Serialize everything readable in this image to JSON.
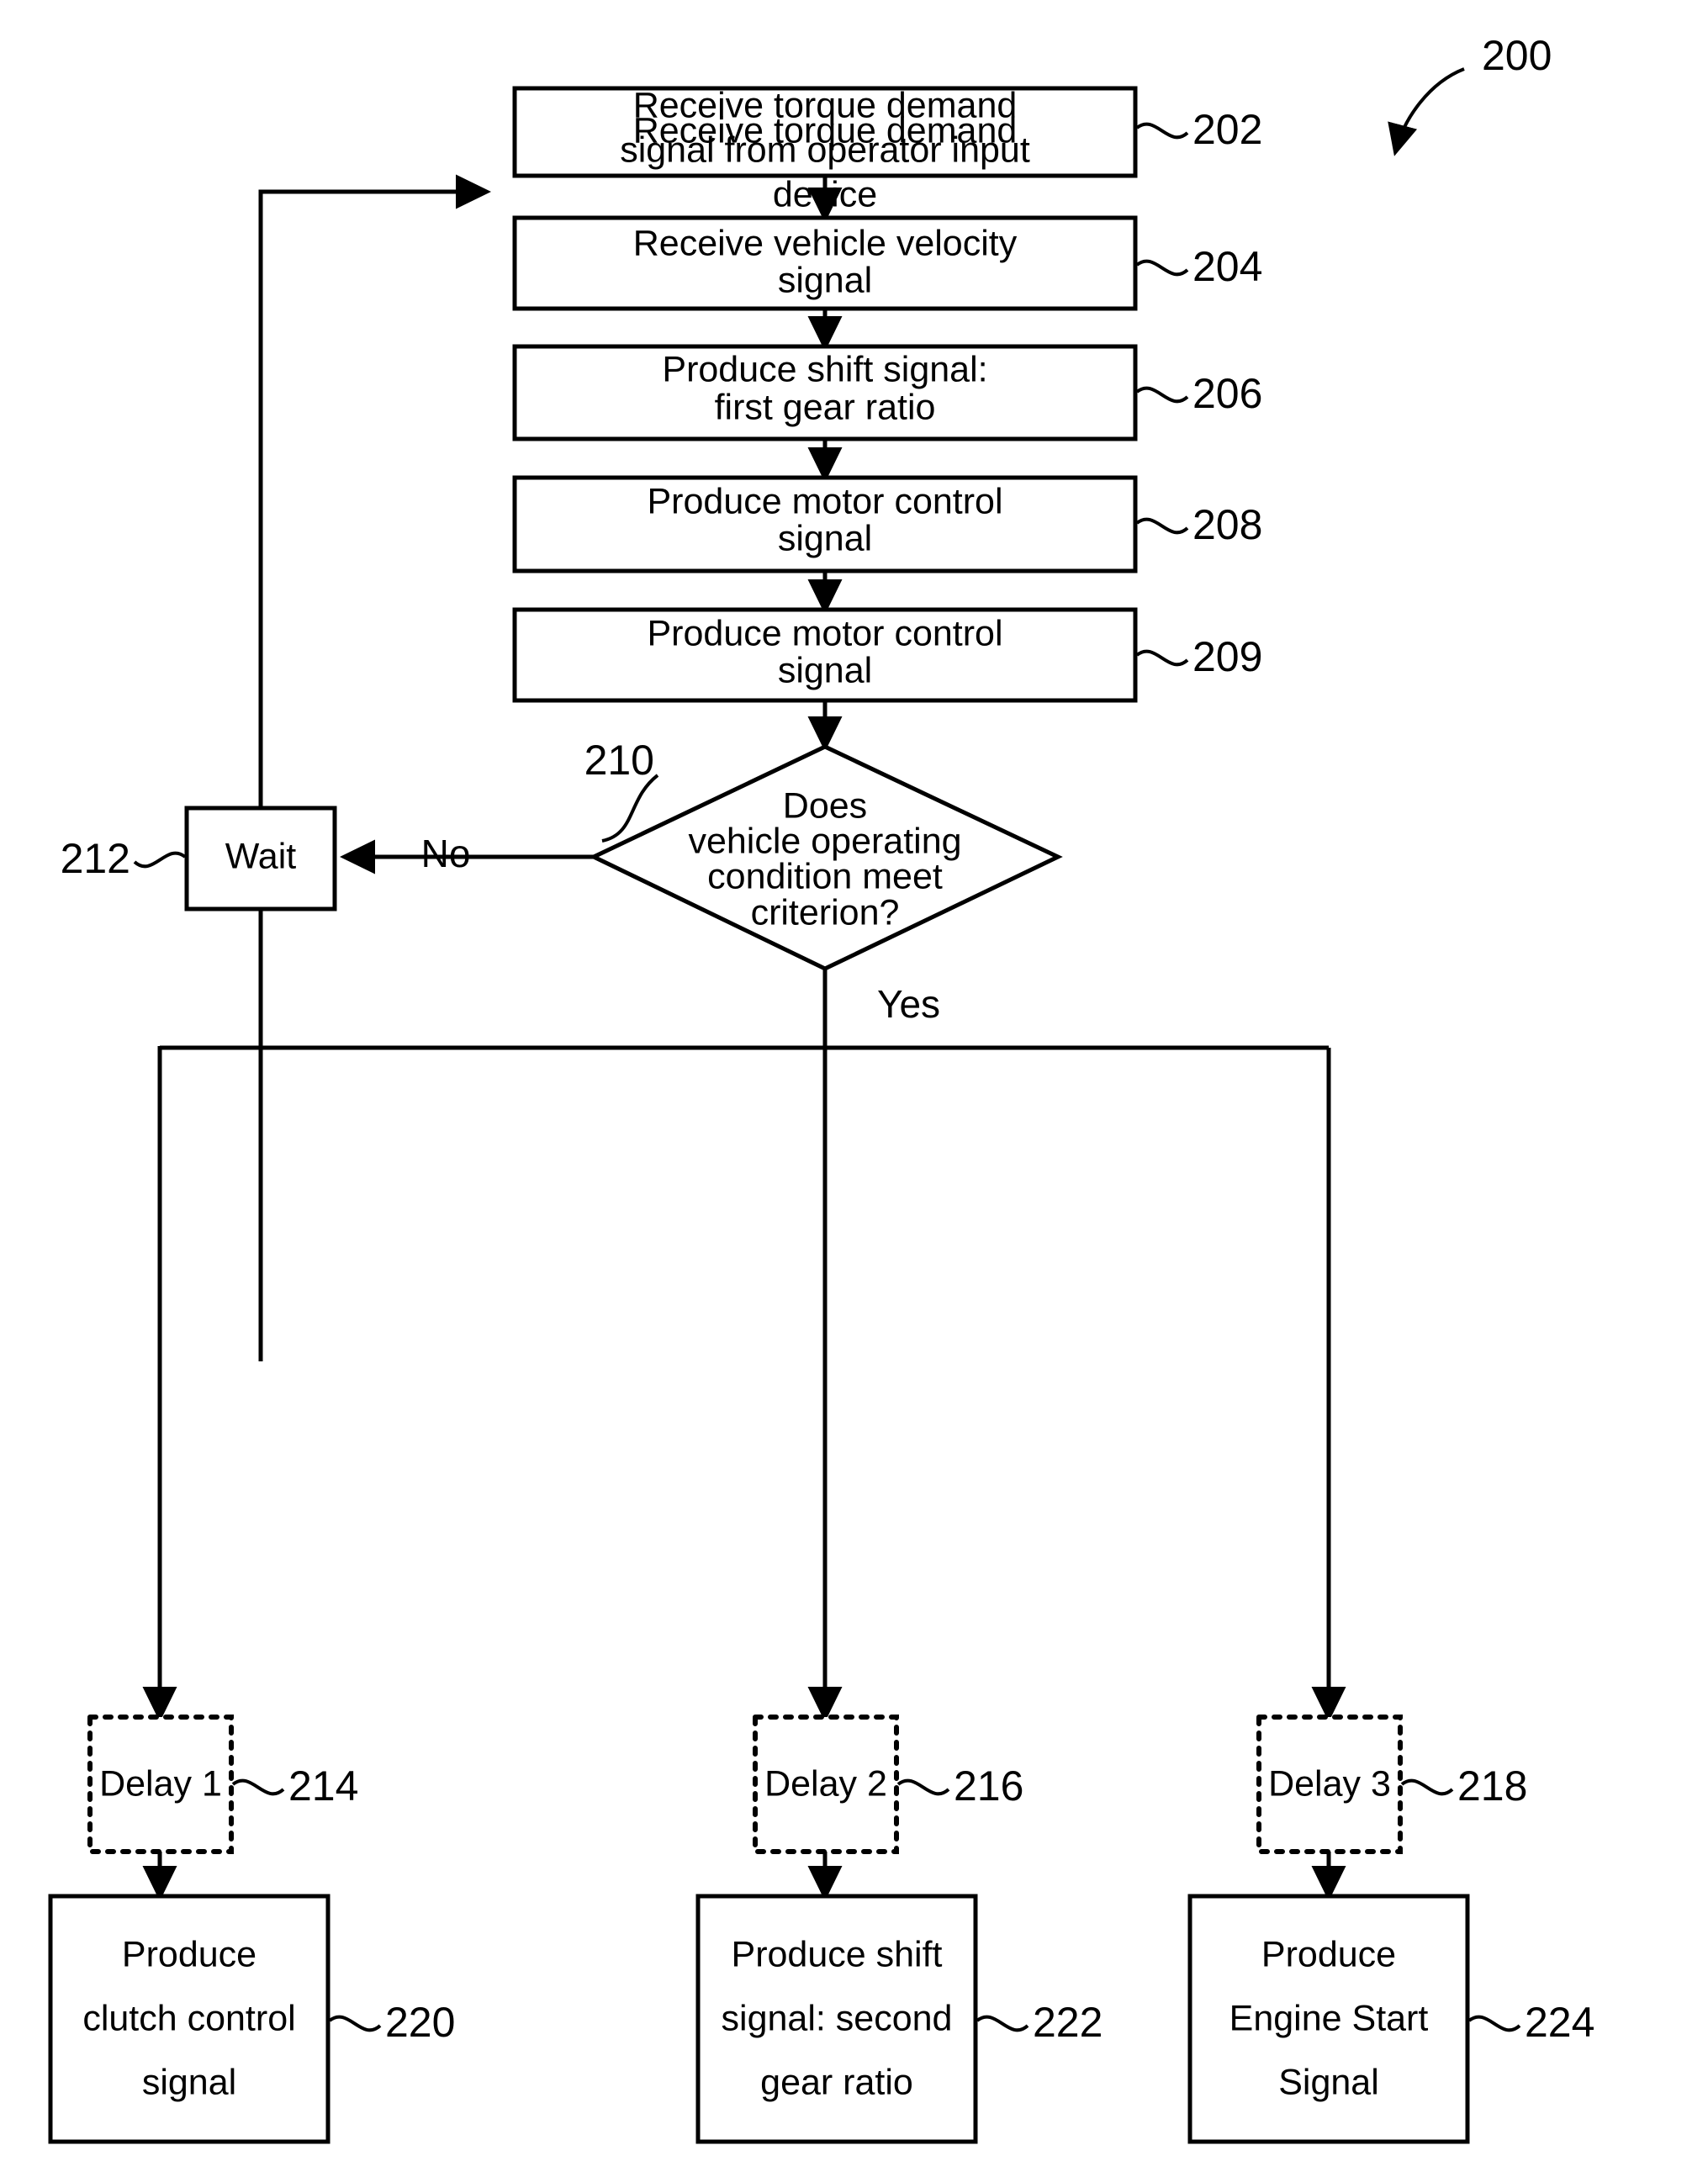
{
  "figure": {
    "figure_number": "200",
    "nodes": [
      {
        "id": "n202",
        "ref": "202",
        "type": "process",
        "lines": [
          "Receive torque demand",
          "signal from operator input",
          "device"
        ]
      },
      {
        "id": "n204",
        "ref": "204",
        "type": "process",
        "lines": [
          "Receive vehicle velocity",
          "signal"
        ]
      },
      {
        "id": "n206",
        "ref": "206",
        "type": "process",
        "lines": [
          "Produce shift signal:",
          "first gear ratio"
        ]
      },
      {
        "id": "n208",
        "ref": "208",
        "type": "process",
        "lines": [
          "Produce motor control",
          "signal"
        ]
      },
      {
        "id": "n209",
        "ref": "209",
        "type": "process",
        "lines": [
          "Produce motor control",
          "signal"
        ]
      },
      {
        "id": "n210",
        "ref": "210",
        "type": "decision",
        "lines": [
          "Does",
          "vehicle operating",
          "condition meet",
          "criterion?"
        ]
      },
      {
        "id": "n212",
        "ref": "212",
        "type": "process",
        "lines": [
          "Wait"
        ]
      },
      {
        "id": "n214",
        "ref": "214",
        "type": "delay",
        "lines": [
          "Delay 1"
        ]
      },
      {
        "id": "n216",
        "ref": "216",
        "type": "delay",
        "lines": [
          "Delay 2"
        ]
      },
      {
        "id": "n218",
        "ref": "218",
        "type": "delay",
        "lines": [
          "Delay 3"
        ]
      },
      {
        "id": "n220",
        "ref": "220",
        "type": "process",
        "lines": [
          "Produce",
          "clutch control",
          "signal"
        ]
      },
      {
        "id": "n222",
        "ref": "222",
        "type": "process",
        "lines": [
          "Produce shift",
          "signal: second",
          "gear ratio"
        ]
      },
      {
        "id": "n224",
        "ref": "224",
        "type": "process",
        "lines": [
          "Produce",
          "Engine Start",
          "Signal"
        ]
      }
    ],
    "branch_labels": {
      "no": "No",
      "yes": "Yes"
    },
    "colors": {
      "stroke": "#000000",
      "fill": "#ffffff"
    }
  }
}
